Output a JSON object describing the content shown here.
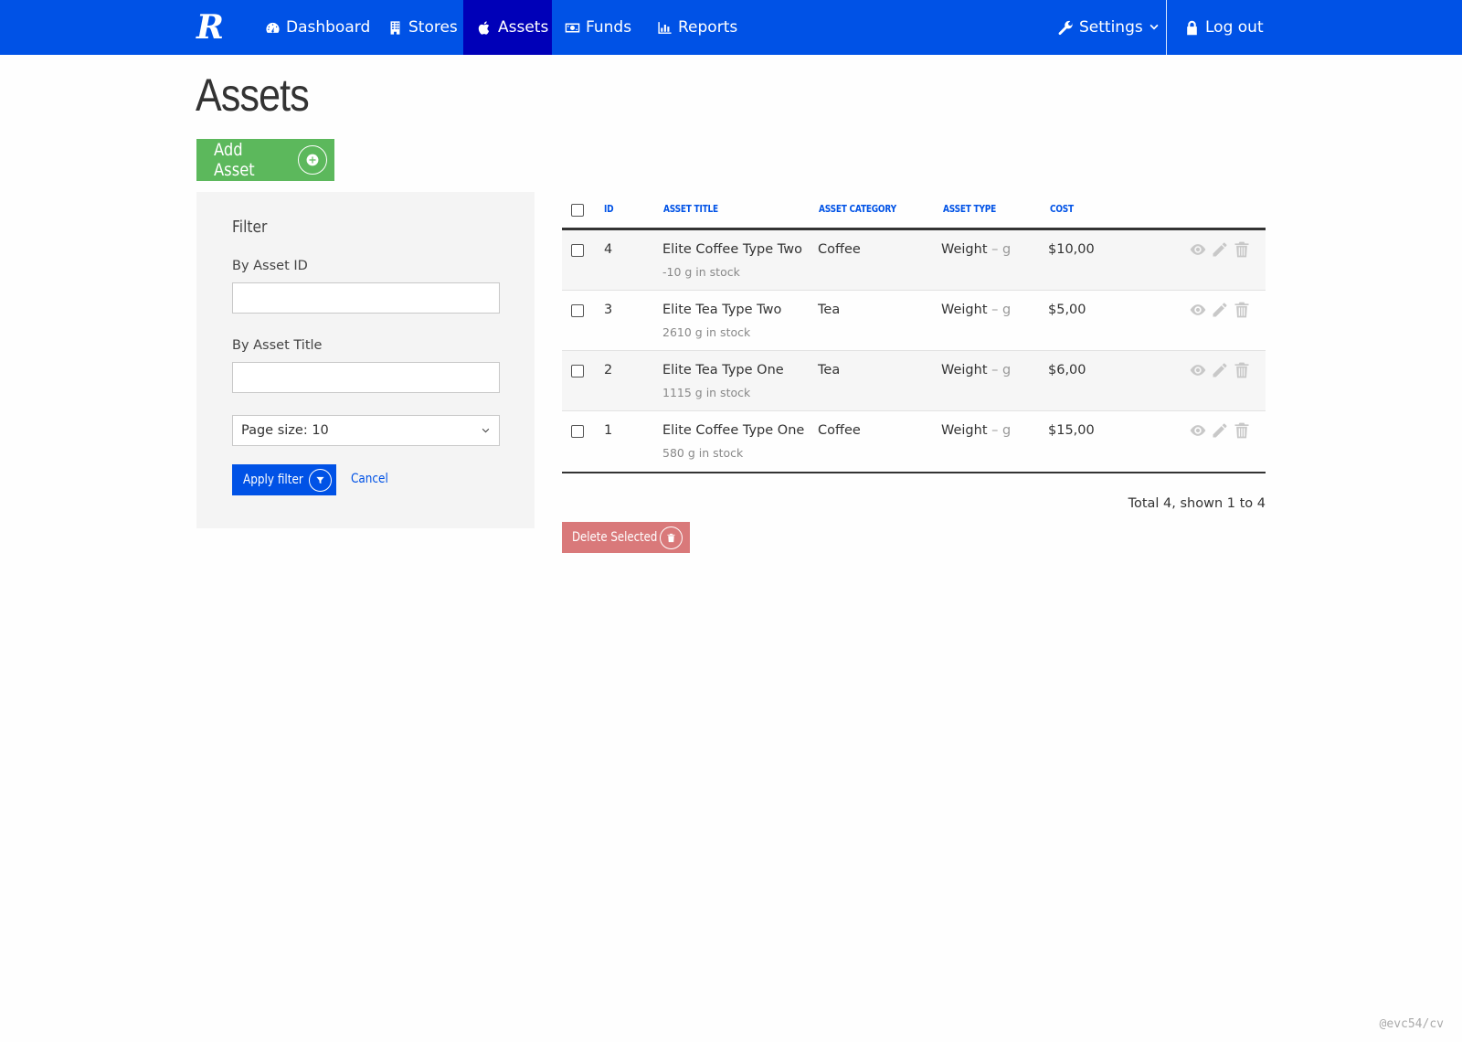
{
  "nav": {
    "logo": "R",
    "items": [
      {
        "label": "Dashboard"
      },
      {
        "label": "Stores"
      },
      {
        "label": "Assets"
      },
      {
        "label": "Funds"
      },
      {
        "label": "Reports"
      }
    ],
    "settings": "Settings",
    "logout": "Log out",
    "active_index": 2,
    "colors": {
      "bar": "#0052e6",
      "active": "#0000b8"
    }
  },
  "page": {
    "title": "Assets",
    "add_button": "Add Asset"
  },
  "filter": {
    "title": "Filter",
    "asset_id_label": "By Asset ID",
    "asset_id_value": "",
    "asset_title_label": "By Asset Title",
    "asset_title_value": "",
    "page_size": "Page size: 10",
    "apply_button": "Apply filter",
    "cancel_link": "Cancel"
  },
  "table": {
    "columns": [
      "ID",
      "ASSET TITLE",
      "ASSET CATEGORY",
      "ASSET TYPE",
      "COST"
    ],
    "rows": [
      {
        "id": "4",
        "title": "Elite Coffee Type Two",
        "stock": "-10 g in stock",
        "category": "Coffee",
        "type": "Weight",
        "unit": "– g",
        "cost": "$10,00"
      },
      {
        "id": "3",
        "title": "Elite Tea Type Two",
        "stock": "2610 g in stock",
        "category": "Tea",
        "type": "Weight",
        "unit": "– g",
        "cost": "$5,00"
      },
      {
        "id": "2",
        "title": "Elite Tea Type One",
        "stock": "1115 g in stock",
        "category": "Tea",
        "type": "Weight",
        "unit": "– g",
        "cost": "$6,00"
      },
      {
        "id": "1",
        "title": "Elite Coffee Type One",
        "stock": "580 g in stock",
        "category": "Coffee",
        "type": "Weight",
        "unit": "– g",
        "cost": "$15,00"
      }
    ],
    "row_actions": [
      "eye-icon",
      "pencil-icon",
      "trash-icon"
    ],
    "pager_info": "Total 4, shown 1 to 4",
    "delete_button": "Delete Selected"
  },
  "watermark": "@evc54/cv"
}
